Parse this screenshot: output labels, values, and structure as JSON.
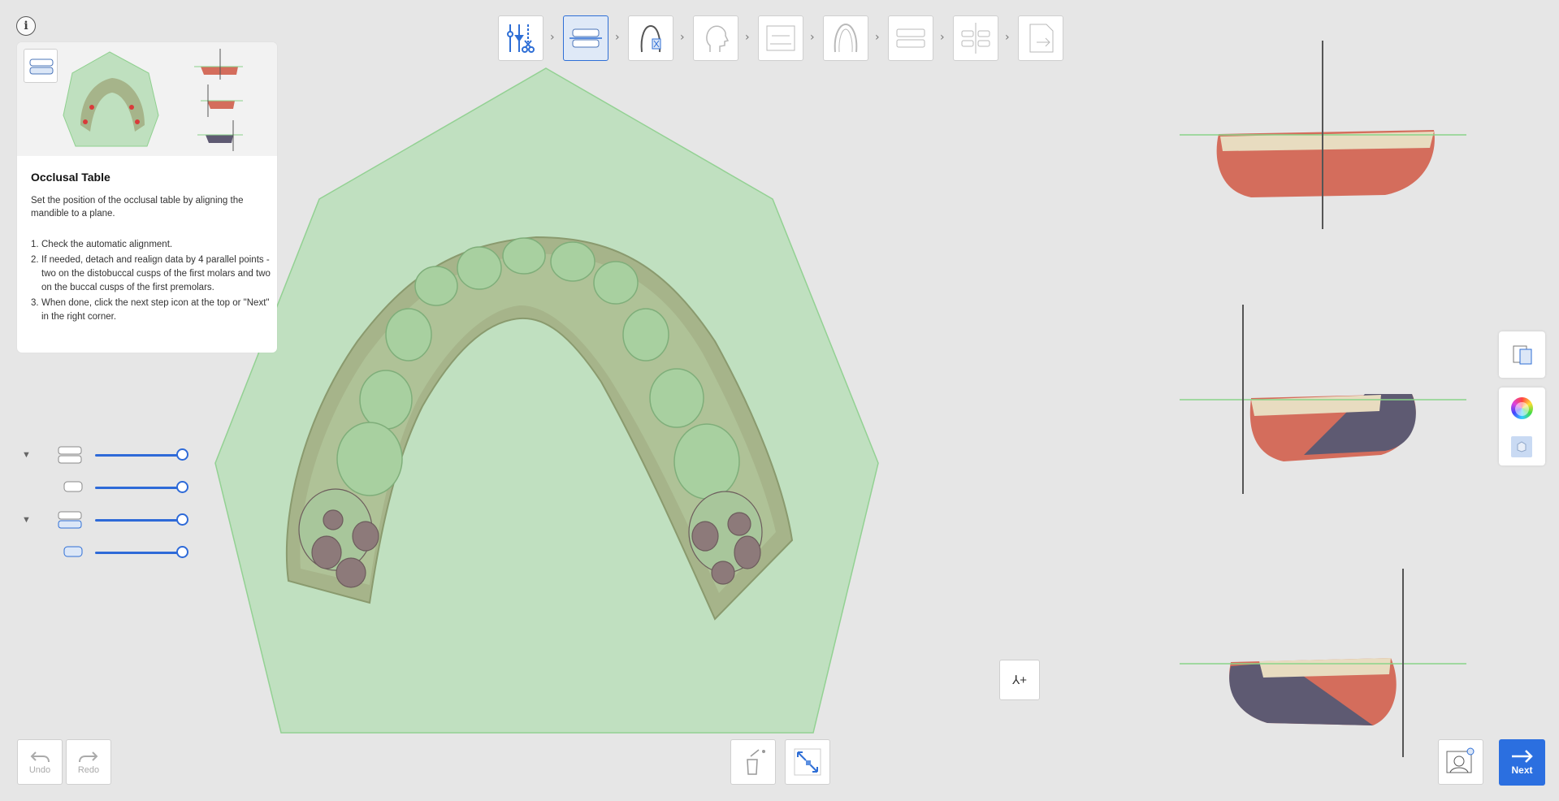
{
  "info_icon": "info-icon",
  "guide": {
    "title": "Occlusal Table",
    "description": "Set the position of the occlusal table by aligning the mandible to a plane.",
    "steps": [
      {
        "num": "1.",
        "text": "Check the automatic alignment."
      },
      {
        "num": "2.",
        "text": "If needed, detach and realign data by 4 parallel points - two on the distobuccal cusps of the first molars and two on the buccal cusps of the first premolars."
      },
      {
        "num": "3.",
        "text": "When done, click the next step icon at the top or \"Next\" in the right corner."
      }
    ]
  },
  "workflow_steps": [
    {
      "name": "data-trim-step",
      "state": "done"
    },
    {
      "name": "occlusal-table-step",
      "state": "active"
    },
    {
      "name": "tooth-setup-step",
      "state": "enabled"
    },
    {
      "name": "face-scan-step",
      "state": "disabled"
    },
    {
      "name": "cbct-step",
      "state": "disabled"
    },
    {
      "name": "arch-design-step",
      "state": "disabled"
    },
    {
      "name": "articulator-step",
      "state": "disabled"
    },
    {
      "name": "analysis-step",
      "state": "disabled"
    },
    {
      "name": "export-step",
      "state": "disabled"
    }
  ],
  "visibility_sliders": [
    {
      "name": "upper-jaw",
      "value": 1.0,
      "collapsible": true
    },
    {
      "name": "upper-jaw-sub",
      "value": 1.0,
      "collapsible": false
    },
    {
      "name": "lower-jaw",
      "value": 1.0,
      "collapsible": true
    },
    {
      "name": "lower-jaw-sub",
      "value": 1.0,
      "collapsible": false
    }
  ],
  "toolbar": {
    "undo_label": "Undo",
    "redo_label": "Redo",
    "next_label": "Next",
    "add_point_label": "⅄+"
  },
  "colors": {
    "accent": "#2b6fe0",
    "plane_fill": "#b9dcb9",
    "plane_stroke": "#8fcf8f",
    "gingiva": "#d9735e",
    "tooth": "#e8dcc0"
  }
}
